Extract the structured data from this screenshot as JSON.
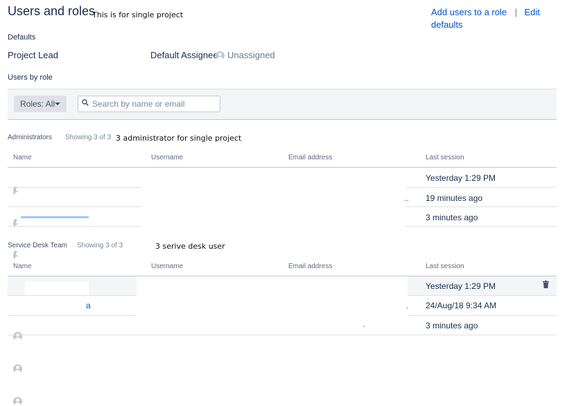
{
  "header": {
    "title": "Users and roles",
    "annotation": "This is for single project",
    "actions": {
      "add_users": "Add users to a role",
      "separator": "|",
      "edit_defaults": "Edit defaults"
    }
  },
  "defaults": {
    "heading": "Defaults",
    "project_lead_label": "Project Lead",
    "default_assignee_label": "Default Assignee",
    "default_assignee_value": "Unassigned"
  },
  "users_by_role": {
    "heading": "Users by role",
    "roles_button": "Roles: All",
    "search_placeholder": "Search by name or email"
  },
  "columns": {
    "name": "Name",
    "username": "Username",
    "email": "Email address",
    "last_session": "Last session"
  },
  "administrators": {
    "title": "Administrators",
    "showing": "Showing 3 of 3",
    "annotation": "3 administrator for single project",
    "rows": [
      {
        "last_session": "Yesterday 1:29 PM",
        "email_fragment": ""
      },
      {
        "last_session": "19 minutes ago",
        "email_fragment": ".."
      },
      {
        "last_session": "3 minutes ago",
        "email_fragment": ""
      }
    ]
  },
  "service_desk_team": {
    "title": "Service Desk Team",
    "showing": "Showing 3 of 3",
    "annotation": "3 serive desk user",
    "rows": [
      {
        "last_session": "Yesterday 1:29 PM",
        "email_fragment": ""
      },
      {
        "last_session": "24/Aug/18 9:34 AM",
        "name_fragment": "a",
        "email_fragment": "."
      },
      {
        "last_session": "3 minutes ago",
        "email_fragment": ","
      }
    ]
  },
  "icons": {
    "search": "search-icon",
    "caret": "chevron-down-icon",
    "avatar": "avatar-icon",
    "delete": "trash-icon"
  },
  "colors": {
    "link": "#0052CC",
    "text": "#172B4D",
    "muted": "#6B778C",
    "filter_bg": "#F4F5F7"
  }
}
